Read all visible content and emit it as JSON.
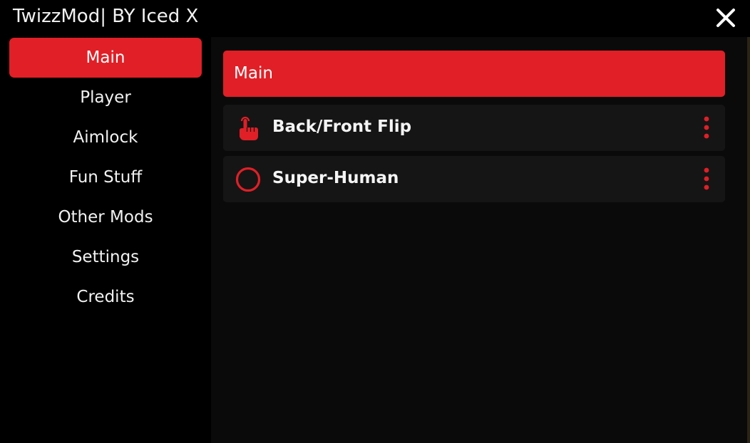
{
  "window": {
    "title": "TwizzMod| BY Iced X",
    "close_icon": "close-icon"
  },
  "sidebar": {
    "items": [
      {
        "label": "Main",
        "active": true
      },
      {
        "label": "Player",
        "active": false
      },
      {
        "label": "Aimlock",
        "active": false
      },
      {
        "label": "Fun Stuff",
        "active": false
      },
      {
        "label": "Other Mods",
        "active": false
      },
      {
        "label": "Settings",
        "active": false
      },
      {
        "label": "Credits",
        "active": false
      }
    ]
  },
  "main": {
    "section_title": "Main",
    "rows": [
      {
        "label": "Back/Front Flip",
        "icon": "tap-hand-icon",
        "menu_icon": "more-vertical-icon"
      },
      {
        "label": "Super-Human",
        "icon": "toggle-off-circle-icon",
        "menu_icon": "more-vertical-icon"
      }
    ]
  },
  "colors": {
    "accent": "#e11f26",
    "background": "#000000",
    "panel": "#0a0a0a",
    "row": "#151515",
    "text": "#f2f2f2"
  }
}
